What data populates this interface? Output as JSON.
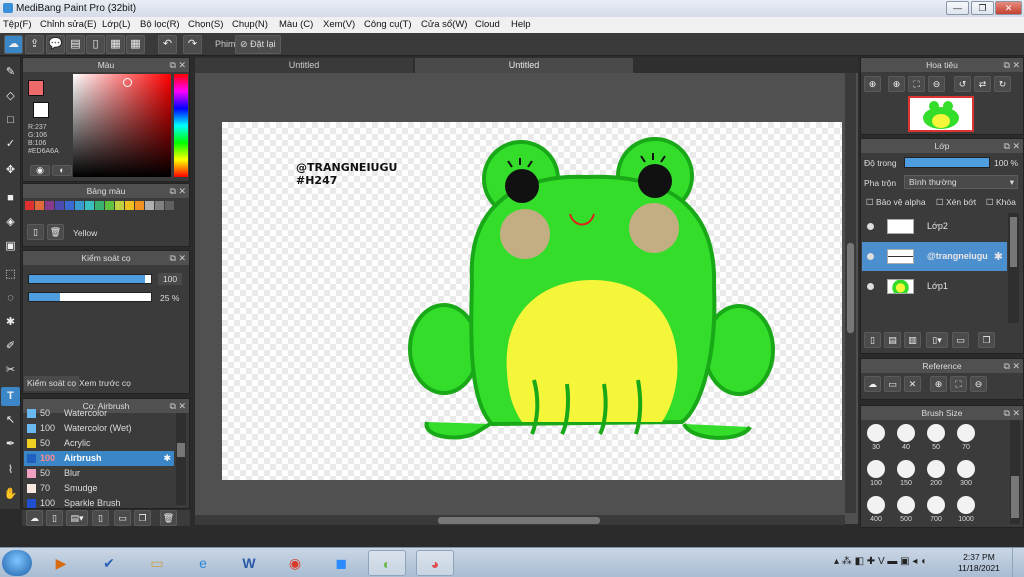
{
  "titlebar": {
    "title": "MediBang Paint Pro (32bit)",
    "minimize": "—",
    "maximize": "❐",
    "close": "✕"
  },
  "menu": [
    "Tệp(F)",
    "Chỉnh sửa(E)",
    "Lớp(L)",
    "Bộ lọc(R)",
    "Chọn(S)",
    "Chụp(N)",
    "Màu (C)",
    "Xem(V)",
    "Công cụ(T)",
    "Cửa sổ(W)",
    "Cloud",
    "Help"
  ],
  "toolbar": {
    "film_label": "Phim",
    "reset_label": "Đặt lại"
  },
  "tabs": [
    "Untitled",
    "Untitled"
  ],
  "color_panel": {
    "title": "Màu",
    "main_color": "#ED6A6A",
    "rgb_lines": [
      "R:237",
      "G:106",
      "B:106",
      "#ED6A6A"
    ]
  },
  "palette_panel": {
    "title": "Bảng màu",
    "colors": [
      "#e03030",
      "#e06a3a",
      "#8a3a8a",
      "#4a4ab0",
      "#3a6ad0",
      "#3a9ad0",
      "#3ac0c0",
      "#3ab070",
      "#60c040",
      "#c0d040",
      "#f0c020",
      "#f09020",
      "#b0b0b0",
      "#808080",
      "#606060"
    ],
    "selected_name": "Yellow"
  },
  "brush_control": {
    "title": "Kiểm soát cọ",
    "size_value": "100",
    "opacity_value": "25 %",
    "size_fraction": 0.95,
    "opacity_fraction": 0.25,
    "subtabs": [
      "Kiểm soát cọ",
      "Xem trước cọ"
    ]
  },
  "brush_panel": {
    "title": "Cọ: Airbrush",
    "items": [
      {
        "size": "50",
        "name": "Watercolor",
        "color": "#6ab8f0"
      },
      {
        "size": "100",
        "name": "Watercolor (Wet)",
        "color": "#6ab8f0"
      },
      {
        "size": "50",
        "name": "Acrylic",
        "color": "#f0d020"
      },
      {
        "size": "100",
        "name": "Airbrush",
        "color": "#2060c0"
      },
      {
        "size": "50",
        "name": "Blur",
        "color": "#f0a0c0"
      },
      {
        "size": "70",
        "name": "Smudge",
        "color": "#f8e8e0"
      },
      {
        "size": "100",
        "name": "Sparkle Brush",
        "color": "#2050d0"
      }
    ]
  },
  "canvas": {
    "watermark_lines": [
      "@TRANGNEIUGU",
      "#H247"
    ]
  },
  "navigator_panel": {
    "title": "Hoa tiêu"
  },
  "layer_panel": {
    "title": "Lớp",
    "opacity_label": "Độ trong",
    "opacity_value": "100 %",
    "blend_label": "Pha trộn",
    "blend_value": "Bình thường",
    "protect_alpha": "Bảo vệ alpha",
    "clipping": "Xén bớt",
    "lock": "Khóa",
    "layers": [
      {
        "name": "Lớp2",
        "selected": false
      },
      {
        "name": "@trangneiugu",
        "selected": true
      },
      {
        "name": "Lớp1",
        "selected": false
      }
    ]
  },
  "reference_panel": {
    "title": "Reference"
  },
  "brush_size_panel": {
    "title": "Brush Size",
    "sizes": [
      "30",
      "40",
      "50",
      "70",
      "100",
      "150",
      "200",
      "300",
      "400",
      "500",
      "700",
      "1000"
    ]
  },
  "taskbar": {
    "time": "2:37 PM",
    "date": "11/18/2021"
  }
}
